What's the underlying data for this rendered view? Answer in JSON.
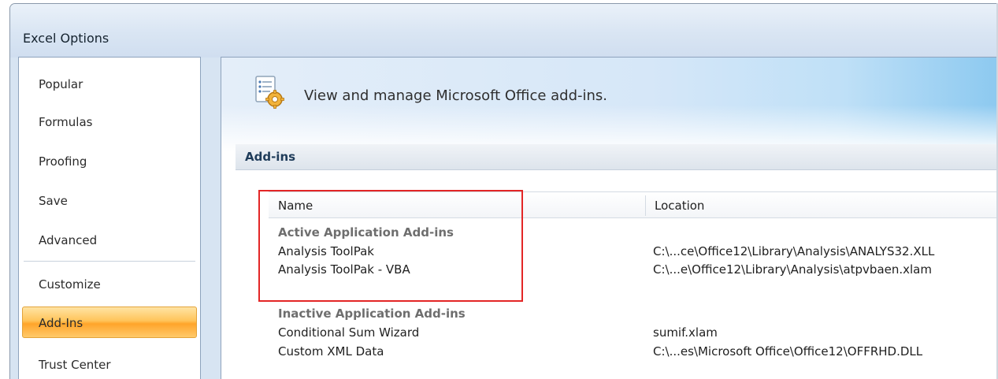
{
  "window": {
    "title": "Excel Options"
  },
  "sidebar": {
    "items": [
      {
        "label": "Popular",
        "active": false
      },
      {
        "label": "Formulas",
        "active": false
      },
      {
        "label": "Proofing",
        "active": false
      },
      {
        "label": "Save",
        "active": false
      },
      {
        "label": "Advanced",
        "active": false
      },
      {
        "label": "Customize",
        "active": false
      },
      {
        "label": "Add-Ins",
        "active": true
      },
      {
        "label": "Trust Center",
        "active": false
      }
    ]
  },
  "main": {
    "banner": {
      "icon": "addins-gear-icon",
      "text": "View and manage Microsoft Office add-ins."
    },
    "section_title": "Add-ins",
    "table": {
      "headers": {
        "name": "Name",
        "location": "Location"
      },
      "groups": [
        {
          "title": "Active Application Add-ins",
          "rows": [
            {
              "name": "Analysis ToolPak",
              "location": "C:\\...ce\\Office12\\Library\\Analysis\\ANALYS32.XLL"
            },
            {
              "name": "Analysis ToolPak - VBA",
              "location": "C:\\...e\\Office12\\Library\\Analysis\\atpvbaen.xlam"
            }
          ]
        },
        {
          "title": "Inactive Application Add-ins",
          "rows": [
            {
              "name": "Conditional Sum Wizard",
              "location": "sumif.xlam"
            },
            {
              "name": "Custom XML Data",
              "location": "C:\\...es\\Microsoft Office\\Office12\\OFFRHD.DLL"
            }
          ]
        }
      ]
    }
  },
  "colors": {
    "active_nav": "#ffc45a",
    "highlight_border": "#e32626",
    "section_header_text": "#1f3c5a"
  }
}
